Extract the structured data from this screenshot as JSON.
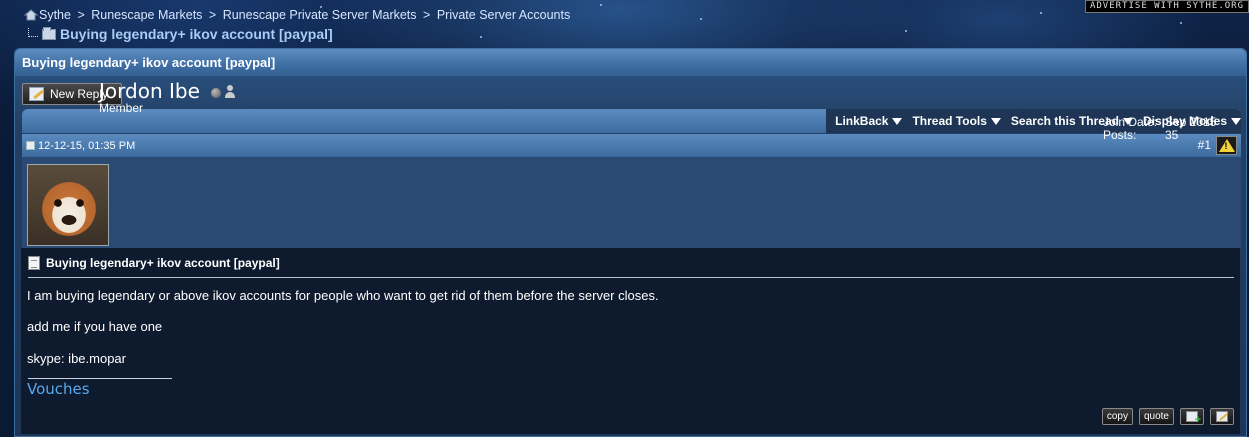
{
  "breadcrumb": {
    "items": [
      "Sythe",
      "Runescape Markets",
      "Runescape Private Server Markets",
      "Private Server Accounts"
    ],
    "current": "Buying legendary+ ikov account [paypal]"
  },
  "ad": {
    "text": "ADVERTISE WITH SYTHE.ORG"
  },
  "thread": {
    "title": "Buying legendary+ ikov account [paypal]",
    "new_reply_label": "New Reply"
  },
  "toolbar": {
    "linkback": "LinkBack",
    "thread_tools": "Thread Tools",
    "search_thread": "Search this Thread",
    "display_modes": "Display Modes"
  },
  "post": {
    "date": "12-12-15, 01:35 PM",
    "number": "#1",
    "username": "Jordon Ibe",
    "rank": "Member",
    "join_date_label": "Join Date:",
    "join_date": "Sep 2015",
    "posts_label": "Posts:",
    "posts": "35",
    "title": "Buying legendary+ ikov account [paypal]",
    "lines": [
      "I am buying legendary or above ikov accounts for people who want to get rid of them before the server closes.",
      "add me if you have one",
      "skype: ibe.mopar"
    ],
    "signature_link": "Vouches",
    "actions": {
      "copy": "copy",
      "quote": "quote"
    }
  }
}
